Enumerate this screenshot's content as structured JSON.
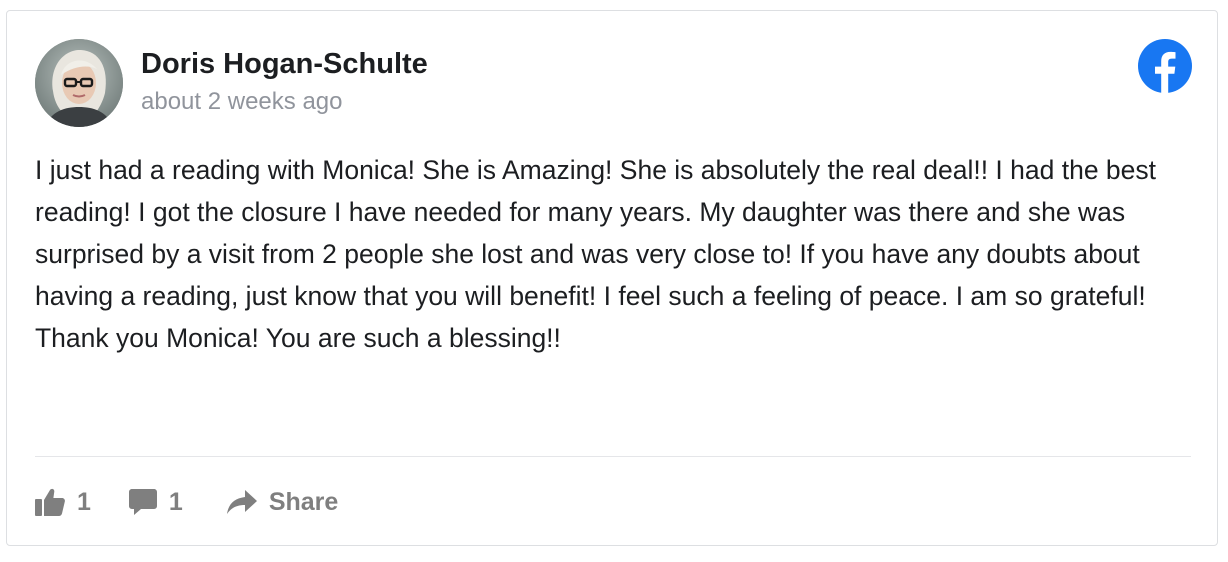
{
  "post": {
    "author_name": "Doris Hogan-Schulte",
    "timestamp": "about 2 weeks ago",
    "body": "I just had a reading with Monica! She is Amazing! She is absolutely the real deal!! I had the best reading! I got the closure I have needed for many years. My daughter was there and she was surprised by a visit from 2 people she lost and was very close to! If you have any doubts about having a reading, just know that you will benefit! I feel such a feeling of peace. I am so grateful! Thank you Monica! You are such a blessing!!",
    "platform_icon": "facebook-icon",
    "brand_color": "#1877f2"
  },
  "actions": {
    "like_count": "1",
    "comment_count": "1",
    "share_label": "Share",
    "like_icon": "thumbs-up-icon",
    "comment_icon": "comment-bubble-icon",
    "share_icon": "share-arrow-icon",
    "icon_color": "#7f7f7f"
  }
}
